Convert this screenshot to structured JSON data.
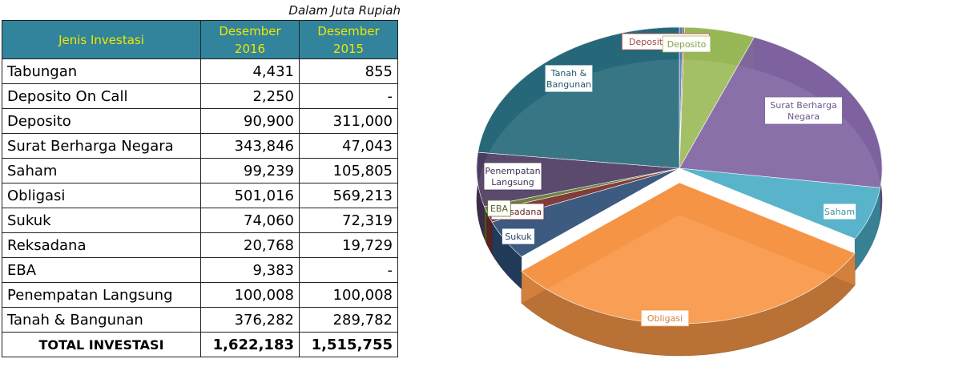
{
  "note": "Dalam Juta Rupiah",
  "table": {
    "headers": [
      "Jenis Investasi",
      "Desember 2016",
      "Desember 2015"
    ],
    "rows": [
      {
        "name": "Tabungan",
        "y2016": "4,431",
        "y2015": "855"
      },
      {
        "name": "Deposito On Call",
        "y2016": "2,250",
        "y2015": "-"
      },
      {
        "name": "Deposito",
        "y2016": "90,900",
        "y2015": "311,000"
      },
      {
        "name": "Surat Berharga Negara",
        "y2016": "343,846",
        "y2015": "47,043"
      },
      {
        "name": "Saham",
        "y2016": "99,239",
        "y2015": "105,805"
      },
      {
        "name": "Obligasi",
        "y2016": "501,016",
        "y2015": "569,213"
      },
      {
        "name": "Sukuk",
        "y2016": "74,060",
        "y2015": "72,319"
      },
      {
        "name": "Reksadana",
        "y2016": "20,768",
        "y2015": "19,729"
      },
      {
        "name": "EBA",
        "y2016": "9,383",
        "y2015": "-"
      },
      {
        "name": "Penempatan Langsung",
        "y2016": "100,008",
        "y2015": "100,008"
      },
      {
        "name": "Tanah & Bangunan",
        "y2016": "376,282",
        "y2015": "289,782"
      }
    ],
    "total": {
      "name": "TOTAL INVESTASI",
      "y2016": "1,622,183",
      "y2015": "1,515,755"
    }
  },
  "chart_data": {
    "type": "pie",
    "title": "",
    "categories": [
      "Tabungan",
      "Deposito On Call",
      "Deposito",
      "Surat Berharga Negara",
      "Saham",
      "Obligasi",
      "Sukuk",
      "Reksadana",
      "EBA",
      "Penempatan Langsung",
      "Tanah & Bangunan"
    ],
    "slice_labels": [
      "",
      "Deposito On Call",
      "Deposito",
      "Surat Berharga Negara",
      "Saham",
      "Obligasi",
      "Sukuk",
      "Reksadana",
      "EBA",
      "Penempatan Langsung",
      "Tanah & Bangunan"
    ],
    "values": [
      4431,
      2250,
      90900,
      343846,
      99239,
      501016,
      74060,
      20768,
      9383,
      100008,
      376282
    ],
    "colors": [
      "#4f81bd",
      "#c0504d",
      "#9bbb59",
      "#8064a2",
      "#4bacc6",
      "#f79646",
      "#2c4d75",
      "#772c2a",
      "#5f7530",
      "#4d3b62",
      "#276a7c"
    ],
    "style": "3d-exploded-pie"
  }
}
